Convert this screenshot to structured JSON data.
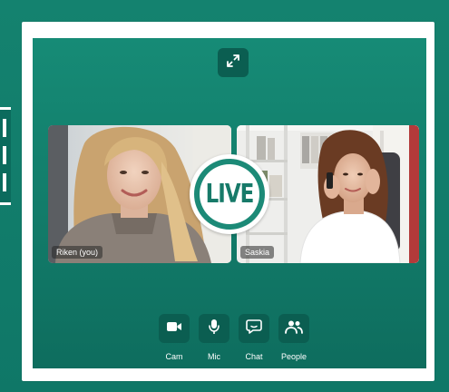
{
  "live_badge": {
    "text": "LIVE"
  },
  "participants": [
    {
      "name": "Riken (you)"
    },
    {
      "name": "Saskia"
    }
  ],
  "controls": {
    "cam": {
      "label": "Cam",
      "icon": "camera-icon"
    },
    "mic": {
      "label": "Mic",
      "icon": "microphone-icon"
    },
    "chat": {
      "label": "Chat",
      "icon": "chat-icon"
    },
    "people": {
      "label": "People",
      "icon": "people-icon"
    }
  },
  "toolbar": {
    "expand_icon": "expand-icon"
  },
  "colors": {
    "background": "#14826f",
    "button": "#0b5e51",
    "frame": "#ffffff"
  }
}
